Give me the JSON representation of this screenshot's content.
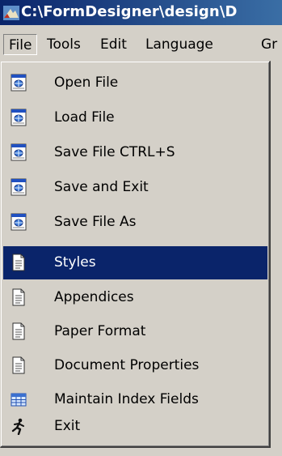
{
  "window": {
    "title": "C:\\FormDesigner\\design\\D"
  },
  "menubar": {
    "items": [
      {
        "label": "File",
        "active": true
      },
      {
        "label": "Tools"
      },
      {
        "label": "Edit"
      },
      {
        "label": "Language"
      },
      {
        "label": "Gr"
      }
    ]
  },
  "file_menu": {
    "items": [
      {
        "label": "Open File",
        "icon": "web-document-icon"
      },
      {
        "label": "Load File",
        "icon": "web-document-icon"
      },
      {
        "label": "Save File CTRL+S",
        "icon": "web-document-icon"
      },
      {
        "label": "Save and Exit",
        "icon": "web-document-icon"
      },
      {
        "label": "Save File As",
        "icon": "web-document-icon"
      },
      {
        "label": "Styles",
        "icon": "document-icon",
        "highlighted": true
      },
      {
        "label": "Appendices",
        "icon": "document-icon"
      },
      {
        "label": "Paper Format",
        "icon": "document-icon"
      },
      {
        "label": "Document Properties",
        "icon": "document-icon"
      },
      {
        "label": "Maintain Index Fields",
        "icon": "grid-icon"
      },
      {
        "label": "Exit",
        "icon": "running-man-icon"
      }
    ]
  },
  "colors": {
    "titlebar_start": "#0a246a",
    "titlebar_end": "#3a6ea5",
    "menu_background": "#d4d0c8",
    "highlight": "#0a246a"
  }
}
